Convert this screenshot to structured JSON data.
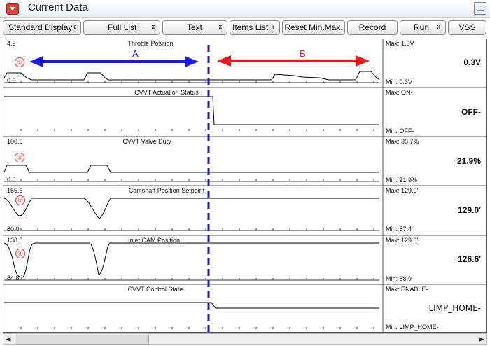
{
  "window": {
    "title": "Current Data"
  },
  "toolbar": {
    "standard_display": "Standard Display",
    "full_list": "Full List",
    "text": "Text",
    "items_list": "Items List",
    "reset_minmax": "Reset Min.Max.",
    "record": "Record",
    "run": "Run",
    "vss": "VSS"
  },
  "annotations": {
    "region_a": "A",
    "region_b": "B",
    "arrow_a_color": "#1a1ae6",
    "arrow_b_color": "#e61a1a",
    "divider_color": "#1a1ae6"
  },
  "panels": [
    {
      "name": "Throttle Position",
      "scale_max": "4.9",
      "scale_min": "0.0",
      "max": "Max:  1.3V",
      "min": "Min:  0.3V",
      "current": "0.3V",
      "marker": "①"
    },
    {
      "name": "CVVT Actuation Status",
      "scale_max": "",
      "scale_min": "",
      "max": "Max: ON-",
      "min": "Min:  OFF-",
      "current": "OFF-",
      "marker": ""
    },
    {
      "name": "CVVT Valve Duty",
      "scale_max": "100.0",
      "scale_min": "0.0",
      "max": "Max:  38.7%",
      "min": "Min:  21.9%",
      "current": "21.9%",
      "marker": "③"
    },
    {
      "name": "Camshaft Position Setpoint",
      "scale_max": "155.6",
      "scale_min": "60.0",
      "max": "Max: 129.0'",
      "min": "Min:  87.4'",
      "current": "129.0'",
      "marker": "②"
    },
    {
      "name": "Inlet CAM Position",
      "scale_max": "138.8",
      "scale_min": "84.8",
      "max": "Max: 129.0'",
      "min": "Min:  88.9'",
      "current": "126.6'",
      "marker": "④"
    },
    {
      "name": "CVVT Control State",
      "scale_max": "",
      "scale_min": "",
      "max": "Max: ENABLE-",
      "min": "Min:  LIMP_HOME-",
      "current": "LIMP_HOME-",
      "marker": ""
    }
  ]
}
